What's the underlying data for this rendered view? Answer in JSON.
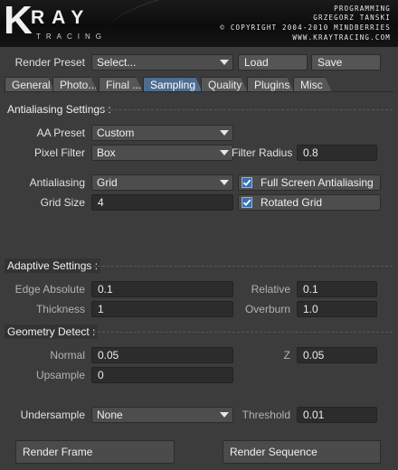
{
  "header": {
    "logo_letter": "K",
    "logo_rest": "RAY",
    "logo_sub": "TRACING",
    "credit_lines": [
      "PROGRAMMING",
      "GRZEGORZ TANSKI",
      "© COPYRIGHT 2004-2010 MINDBERRIES",
      "WWW.KRAYTRACING.COM"
    ]
  },
  "render_preset": {
    "label": "Render Preset",
    "value": "Select...",
    "load_label": "Load",
    "save_label": "Save"
  },
  "tabs": [
    {
      "label": "General"
    },
    {
      "label": "Photo..."
    },
    {
      "label": "Final ..."
    },
    {
      "label": "Sampling",
      "active": true
    },
    {
      "label": "Quality"
    },
    {
      "label": "Plugins"
    },
    {
      "label": "Misc"
    }
  ],
  "antialiasing": {
    "section_title": "Antialiasing Settings :",
    "aa_preset_label": "AA Preset",
    "aa_preset_value": "Custom",
    "pixel_filter_label": "Pixel Filter",
    "pixel_filter_value": "Box",
    "filter_radius_label": "Filter Radius",
    "filter_radius_value": "0.8",
    "antialiasing_label": "Antialiasing",
    "antialiasing_value": "Grid",
    "grid_size_label": "Grid Size",
    "grid_size_value": "4",
    "full_screen_label": "Full Screen Antialiasing",
    "full_screen_checked": true,
    "rotated_grid_label": "Rotated Grid",
    "rotated_grid_checked": true
  },
  "adaptive": {
    "section_title": "Adaptive Settings :",
    "edge_absolute_label": "Edge Absolute",
    "edge_absolute_value": "0.1",
    "relative_label": "Relative",
    "relative_value": "0.1",
    "thickness_label": "Thickness",
    "thickness_value": "1",
    "overburn_label": "Overburn",
    "overburn_value": "1.0"
  },
  "geometry": {
    "section_title": "Geometry Detect :",
    "normal_label": "Normal",
    "normal_value": "0.05",
    "z_label": "Z",
    "z_value": "0.05",
    "upsample_label": "Upsample",
    "upsample_value": "0"
  },
  "undersample": {
    "label": "Undersample",
    "value": "None",
    "threshold_label": "Threshold",
    "threshold_value": "0.01"
  },
  "bottom": {
    "render_frame_label": "Render Frame",
    "render_sequence_label": "Render Sequence"
  },
  "colors": {
    "background": "#3c3c3c",
    "active_tab": "#4e6d8e",
    "checkbox": "#3a6fb0"
  }
}
